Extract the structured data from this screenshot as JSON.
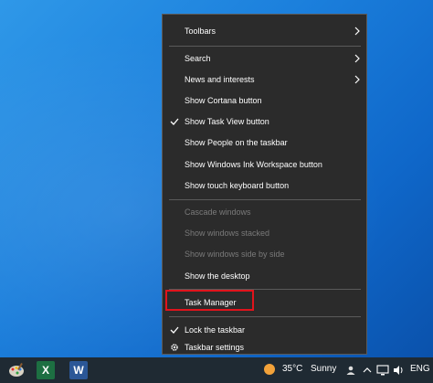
{
  "context_menu": {
    "items": [
      {
        "label": "Toolbars",
        "checked": false,
        "submenu": true,
        "disabled": false
      },
      {
        "label": "Search",
        "checked": false,
        "submenu": true,
        "disabled": false
      },
      {
        "label": "News and interests",
        "checked": false,
        "submenu": true,
        "disabled": false
      },
      {
        "label": "Show Cortana button",
        "checked": false,
        "submenu": false,
        "disabled": false
      },
      {
        "label": "Show Task View button",
        "checked": true,
        "submenu": false,
        "disabled": false
      },
      {
        "label": "Show People on the taskbar",
        "checked": false,
        "submenu": false,
        "disabled": false
      },
      {
        "label": "Show Windows Ink Workspace button",
        "checked": false,
        "submenu": false,
        "disabled": false
      },
      {
        "label": "Show touch keyboard button",
        "checked": false,
        "submenu": false,
        "disabled": false
      },
      {
        "label": "Cascade windows",
        "checked": false,
        "submenu": false,
        "disabled": true
      },
      {
        "label": "Show windows stacked",
        "checked": false,
        "submenu": false,
        "disabled": true
      },
      {
        "label": "Show windows side by side",
        "checked": false,
        "submenu": false,
        "disabled": true
      },
      {
        "label": "Show the desktop",
        "checked": false,
        "submenu": false,
        "disabled": false
      },
      {
        "label": "Task Manager",
        "checked": false,
        "submenu": false,
        "disabled": false,
        "highlighted": true
      },
      {
        "label": "Lock the taskbar",
        "checked": true,
        "submenu": false,
        "disabled": false
      },
      {
        "label": "Taskbar settings",
        "checked": false,
        "submenu": false,
        "disabled": false,
        "icon": "gear-icon"
      }
    ]
  },
  "taskbar": {
    "apps": [
      {
        "name": "paint-app-icon"
      },
      {
        "name": "excel-app-icon",
        "letter": "X"
      },
      {
        "name": "word-app-icon",
        "letter": "W"
      }
    ],
    "weather": {
      "temperature": "35°C",
      "condition": "Sunny"
    },
    "language": "ENG"
  },
  "colors": {
    "menu_bg": "#2b2b2b",
    "highlight_border": "#e0141c",
    "taskbar_bg": "#1f2a33"
  }
}
